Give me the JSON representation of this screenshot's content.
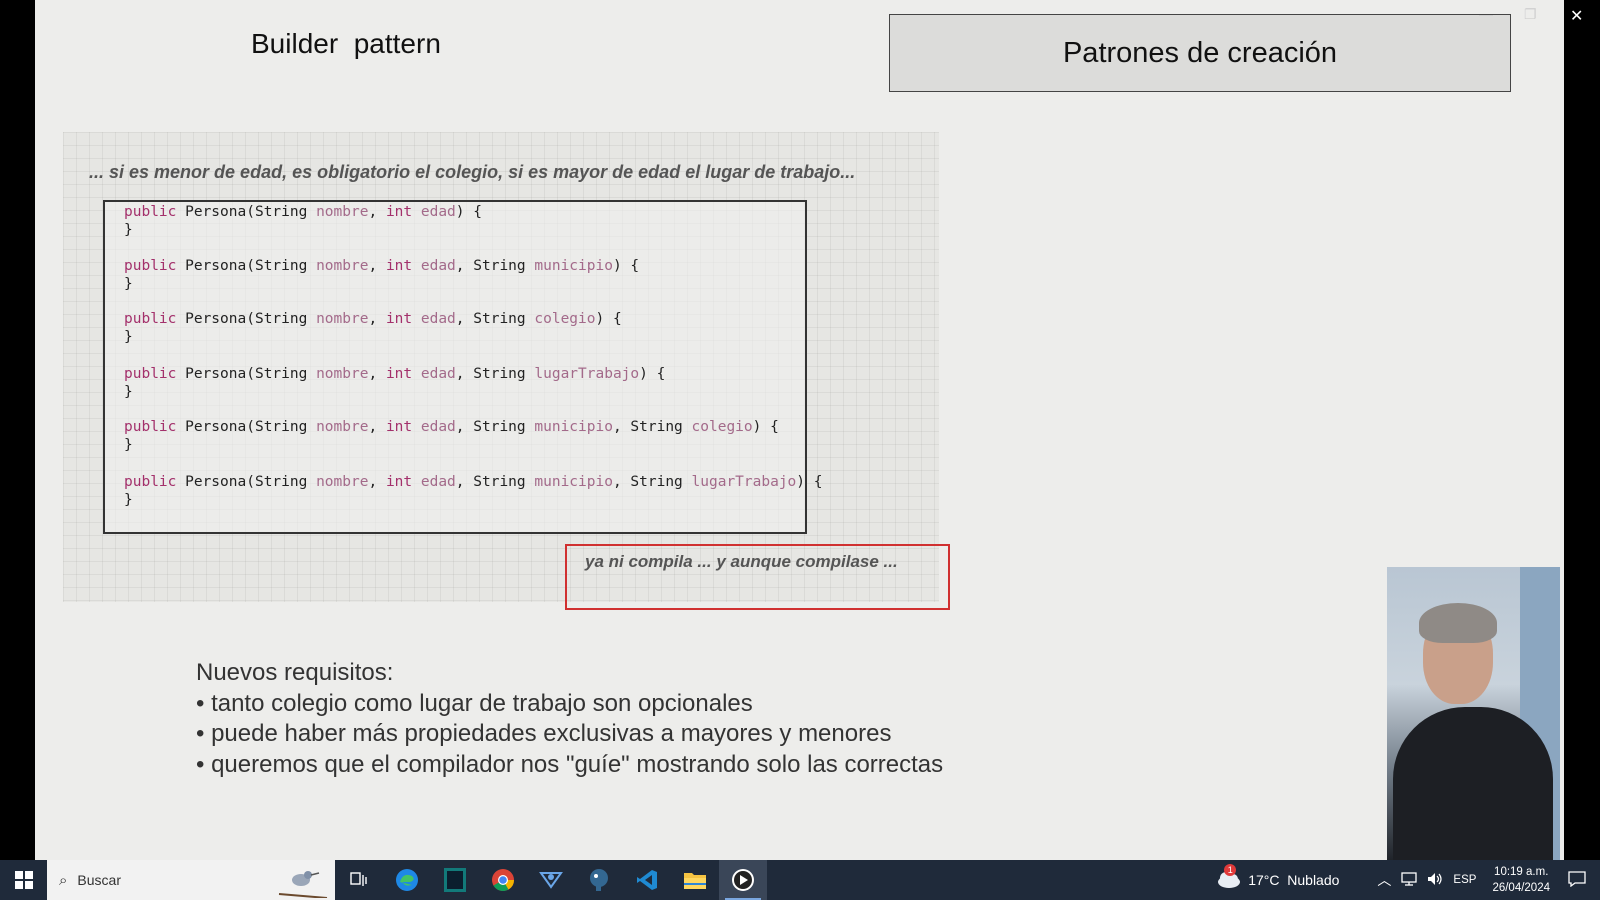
{
  "slide": {
    "title": "Builder  pattern",
    "topic": "Patrones de creación",
    "paper_heading": "... si es menor de edad, es obligatorio el colegio, si es mayor de edad el lugar de trabajo...",
    "code": [
      {
        "kw": "public",
        "name": " Persona(String ",
        "p1": "nombre",
        "s1": ", ",
        "kw2": "int",
        "p2": " edad",
        "rest": ") {"
      },
      {
        "close": "}"
      },
      {
        "kw": "public",
        "name": " Persona(String ",
        "p1": "nombre",
        "s1": ", ",
        "kw2": "int",
        "p2": " edad",
        "s2": ", String ",
        "p3": "municipio",
        "rest": ") {"
      },
      {
        "close": "}"
      },
      {
        "kw": "public",
        "name": " Persona(String ",
        "p1": "nombre",
        "s1": ", ",
        "kw2": "int",
        "p2": " edad",
        "s2": ", String ",
        "p3": "colegio",
        "rest": ") {"
      },
      {
        "close": "}"
      },
      {
        "kw": "public",
        "name": " Persona(String ",
        "p1": "nombre",
        "s1": ", ",
        "kw2": "int",
        "p2": " edad",
        "s2": ", String ",
        "p3": "lugarTrabajo",
        "rest": ") {"
      },
      {
        "close": "}"
      },
      {
        "kw": "public",
        "name": " Persona(String ",
        "p1": "nombre",
        "s1": ", ",
        "kw2": "int",
        "p2": " edad",
        "s2": ", String ",
        "p3": "municipio",
        "s3": ", String ",
        "p4": "colegio",
        "rest": ") {"
      },
      {
        "close": "}"
      },
      {
        "kw": "public",
        "name": " Persona(String ",
        "p1": "nombre",
        "s1": ", ",
        "kw2": "int",
        "p2": " edad",
        "s2": ", String ",
        "p3": "municipio",
        "s3": ", String ",
        "p4": "lugarTrabajo",
        "rest": ") {"
      },
      {
        "close": "}"
      }
    ],
    "error_note": "ya ni compila ... y aunque compilase ...",
    "requirements": {
      "heading": "Nuevos requisitos:",
      "items": [
        "• tanto colegio como lugar de trabajo son opcionales",
        "• puede haber más propiedades exclusivas a mayores y menores",
        "• queremos que el compilador nos \"guíe\" mostrando solo las correctas"
      ]
    }
  },
  "taskbar": {
    "search_placeholder": "Buscar",
    "apps": [
      "task-view-icon",
      "edge-icon",
      "intellij-icon",
      "chrome-icon",
      "app-icon",
      "postgres-icon",
      "vscode-icon",
      "file-explorer-icon",
      "media-player-icon"
    ],
    "weather_badge": "1",
    "weather": "17°C  Nublado",
    "language": "ESP",
    "time": "10:19 a.m.",
    "date": "26/04/2024"
  },
  "window": {
    "close_glyph": "✕"
  }
}
